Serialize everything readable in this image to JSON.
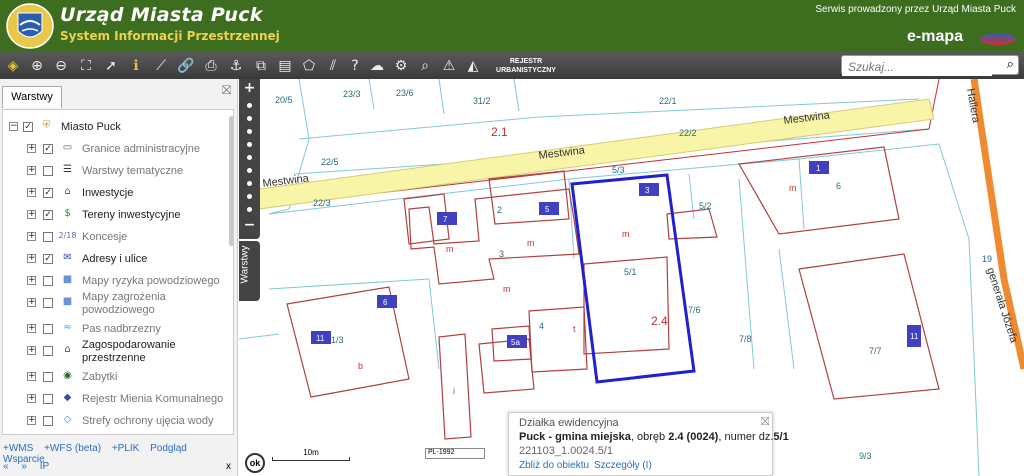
{
  "header": {
    "title": "Urząd Miasta Puck",
    "subtitle": "System Informacji Przestrzennej",
    "service": "Serwis prowadzony przez Urząd Miasta Puck",
    "brand": "e-mapa",
    "colors": {
      "header_bg": "#3d6e1f",
      "subtitle": "#f0d050"
    }
  },
  "toolbar": {
    "rejestr_line1": "REJESTR",
    "rejestr_line2": "URBANISTYCZNY"
  },
  "search": {
    "placeholder": "Szukaj..."
  },
  "panel": {
    "tab": "Warstwy",
    "root": "Miasto Puck",
    "items": [
      {
        "label": "Granice administracyjne",
        "checked": true,
        "active": false,
        "icon": "boundary-icon"
      },
      {
        "label": "Warstwy tematyczne",
        "checked": false,
        "active": false,
        "icon": "stack-icon"
      },
      {
        "label": "Inwestycje",
        "checked": true,
        "active": true,
        "icon": "factory-icon"
      },
      {
        "label": "Tereny inwestycyjne",
        "checked": true,
        "active": true,
        "icon": "dollar-icon"
      },
      {
        "label": "Koncesje",
        "checked": false,
        "active": false,
        "icon": "calendar-icon",
        "icon_text": "2/18"
      },
      {
        "label": "Adresy i ulice",
        "checked": true,
        "active": true,
        "icon": "envelope-icon"
      },
      {
        "label": "Mapy ryzyka powodziowego",
        "checked": false,
        "active": false,
        "icon": "flood-risk-icon"
      },
      {
        "label1": "Mapy zagrożenia",
        "label2": "powodziowego",
        "checked": false,
        "active": false,
        "icon": "flood-hazard-icon"
      },
      {
        "label": "Pas nadbrzezny",
        "checked": false,
        "active": false,
        "icon": "waves-icon"
      },
      {
        "label1": "Zagospodarowanie",
        "label2": "przestrzenne",
        "checked": false,
        "active": true,
        "icon": "zoning-icon"
      },
      {
        "label": "Zabytki",
        "checked": false,
        "active": false,
        "icon": "monument-icon"
      },
      {
        "label": "Rejestr Mienia Komunalnego",
        "checked": false,
        "active": false,
        "icon": "property-icon"
      },
      {
        "label": "Strefy ochrony ujęcia wody",
        "checked": false,
        "active": false,
        "icon": "water-zone-icon"
      }
    ],
    "links": [
      "+WMS",
      "+WFS (beta)",
      "+PLIK",
      "Podgląd",
      "Wsparcie"
    ],
    "links2": [
      "«",
      "»",
      "IP"
    ],
    "close_x": "x"
  },
  "map": {
    "warstwy_side": "Warstwy",
    "ok": "ok",
    "scale": "10m",
    "crs": "PL-1992",
    "labels": {
      "parcel_20_5": "20/5",
      "parcel_23_3_a": "23/3",
      "parcel_23_6": "23/6",
      "parcel_31_2": "31/2",
      "parcel_22_1": "22/1",
      "zone_2_1": "2.1",
      "parcel_22_2": "22/2",
      "street_mestwina_1": "Mestwina",
      "street_mestwina_2": "Mestwina",
      "street_mestwina_3": "Mestwina",
      "parcel_22_5": "22/5",
      "parcel_5_3": "5/3",
      "parcel_22_3": "22/3",
      "parcel_2": "2",
      "parcel_6": "6",
      "parcel_5_2": "5/2",
      "parcel_3": "3",
      "parcel_5_1": "5/1",
      "zone_2_4": "2.4",
      "parcel_7_6": "7/6",
      "parcel_1_3": "1/3",
      "parcel_4": "4",
      "parcel_7_8": "7/8",
      "parcel_7_7": "7/7",
      "parcel_19": "19",
      "parcel_9_3": "9/3",
      "street_generala": "generała Józefa",
      "street_hallera": "Hallera",
      "bld_m1": "m",
      "bld_m2": "m",
      "bld_m3": "m",
      "bld_m4": "m",
      "bld_m5": "m",
      "bld_b": "b",
      "bld_t": "t",
      "bld_i": "i",
      "num_1": "1",
      "num_3": "3",
      "num_5": "5",
      "num_7": "7",
      "num_6": "6",
      "num_11": "11",
      "num_5a": "5a",
      "num_11b": "11"
    }
  },
  "popup": {
    "title": "Działka ewidencyjna",
    "name_bold": "Puck - gmina miejska",
    "text_mid": ", obręb ",
    "obreb_bold": "2.4 (0024)",
    "text_nr": ", numer dz.",
    "nr_bold": "5/1",
    "id": "221103_1.0024.5/1",
    "link1": "Zbliż do obiektu",
    "link2": "Szczegóły (I)"
  }
}
